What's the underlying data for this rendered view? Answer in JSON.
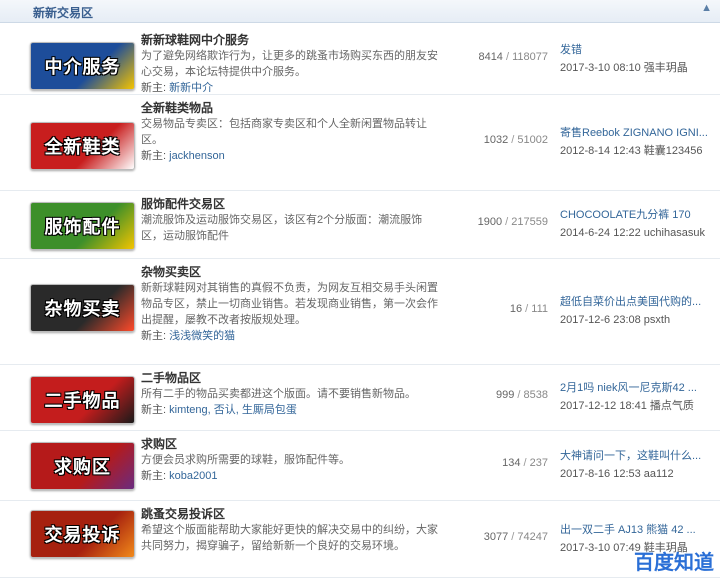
{
  "header": {
    "title": "新新交易区",
    "collapse_icon": "▲"
  },
  "forums": [
    {
      "logo_text": "中介服务",
      "logo_bg": "#1d4d9a",
      "logo_accent": "#f5c400",
      "name": "新新球鞋网中介服务",
      "desc": "为了避免网络欺诈行为，让更多的跳蚤市场购买东西的朋友安心交易，本论坛特提供中介服务。",
      "mod_label": "新主:",
      "mod": "新新中介",
      "threads": "8414",
      "posts": "118077",
      "last_title": "发错",
      "last_time": "2017-3-10 08:10 强丰玥晶"
    },
    {
      "logo_text": "全新鞋类",
      "logo_bg": "#c81e1e",
      "logo_accent": "#ffffff",
      "name": "全新鞋类物品",
      "desc": "交易物品专卖区：包括商家专卖区和个人全新闲置物品转让区。",
      "mod_label": "新主:",
      "mod": "jackhenson",
      "threads": "1032",
      "posts": "51002",
      "last_title": "寄售Reebok ZIGNANO IGNI...",
      "last_time": "2012-8-14 12:43 鞋囊123456"
    },
    {
      "logo_text": "服饰配件",
      "logo_bg": "#3d8f2a",
      "logo_accent": "#f4c400",
      "name": "服饰配件交易区",
      "desc": "潮流服饰及运动服饰交易区，该区有2个分版面：潮流服饰区，运动服饰配件",
      "mod_label": "",
      "mod": "",
      "threads": "1900",
      "posts": "217559",
      "last_title": "CHOCOOLATE九分裤 170",
      "last_time": "2014-6-24 12:22 uchihasasuk"
    },
    {
      "logo_text": "杂物买卖",
      "logo_bg": "#2a2a2a",
      "logo_accent": "#ff4a2a",
      "name": "杂物买卖区",
      "desc": "新新球鞋网对其销售的真假不负责，为网友互相交易手头闲置物品专区，禁止一切商业销售。若发现商业销售，第一次会作出提醒，屡教不改者按版规处理。",
      "mod_label": "新主:",
      "mod": "浅浅微笑的猫",
      "threads": "16",
      "posts": "111",
      "last_title": "超低自菜价出点美国代购的...",
      "last_time": "2017-12-6 23:08 psxth"
    },
    {
      "logo_text": "二手物品",
      "logo_bg": "#c41d1d",
      "logo_accent": "#1a1a1a",
      "name": "二手物品区",
      "desc": "所有二手的物品买卖都进这个版面。请不要销售新物品。",
      "mod_label": "新主:",
      "mod": "kimteng, 否认, 生厮局包蛋",
      "threads": "999",
      "posts": "8538",
      "last_title": "2月1吗 niek风一尼克斯42 ...",
      "last_time": "2017-12-12 18:41 播点气质"
    },
    {
      "logo_text": "求购区",
      "logo_bg": "#b51a1a",
      "logo_accent": "#6a2b80",
      "name": "求购区",
      "desc": "方便会员求购所需要的球鞋，服饰配件等。",
      "mod_label": "新主:",
      "mod": "koba2001",
      "threads": "134",
      "posts": "237",
      "last_title": "大神请问一下，这鞋叫什么...",
      "last_time": "2017-8-16 12:53 aa112"
    },
    {
      "logo_text": "交易投诉",
      "logo_bg": "#a6210f",
      "logo_accent": "#f28a1a",
      "name": "跳蚤交易投诉区",
      "desc": "希望这个版面能帮助大家能好更快的解决交易中的纠纷，大家共同努力，揭穿骗子，留给新新一个良好的交易环境。",
      "mod_label": "",
      "mod": "",
      "threads": "3077",
      "posts": "74247",
      "last_title": "出一双二手 AJ13 熊猫 42 ...",
      "last_time": "2017-3-10 07:49 鞋丰玥晶"
    }
  ],
  "watermark": "百度知道"
}
